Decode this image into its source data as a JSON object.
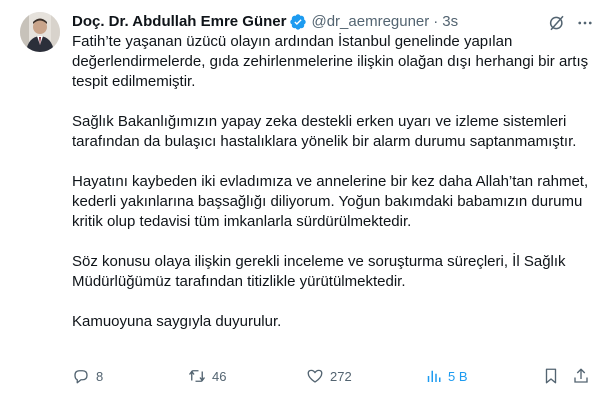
{
  "author": {
    "display_name": "Doç. Dr. Abdullah Emre Güner",
    "handle": "@dr_aemreguner",
    "separator": "·",
    "time": "3s",
    "verified_icon": "verified-badge-icon",
    "badge_color": "#1d9bf0"
  },
  "tweet": {
    "paragraphs": [
      "Fatih’te yaşanan üzücü olayın ardından İstanbul genelinde yapılan değerlendirmelerde, gıda zehirlenmelerine ilişkin olağan dışı herhangi bir artış tespit edilmemiştir.",
      "Sağlık Bakanlığımızın yapay zeka destekli erken uyarı ve izleme sistemleri tarafından da bulaşıcı hastalıklara yönelik bir alarm durumu saptanmamıştır.",
      "Hayatını kaybeden iki evladımıza ve annelerine bir kez daha Allah’tan rahmet, kederli yakınlarına başsağlığı diliyorum. Yoğun bakımdaki babamızın durumu kritik olup tedavisi tüm imkanlarla sürdürülmektedir.",
      "Söz konusu olaya ilişkin gerekli inceleme ve soruşturma süreçleri, İl Sağlık Müdürlüğümüz tarafından titizlikle yürütülmektedir.",
      "Kamuoyuna saygıyla duyurulur."
    ]
  },
  "actions": {
    "replies": "8",
    "reposts": "46",
    "likes": "272",
    "views": "5 B",
    "views_color": "#1d9bf0",
    "icon_color": "#536471"
  }
}
